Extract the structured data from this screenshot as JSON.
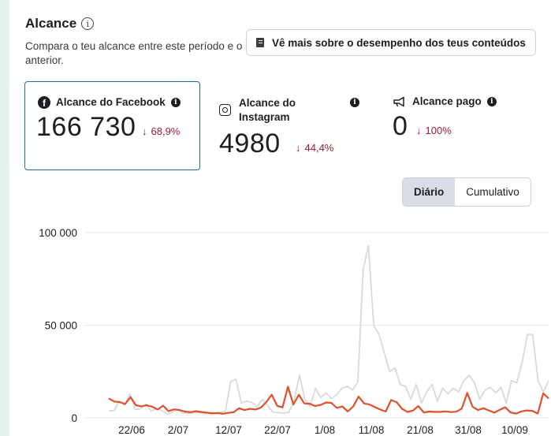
{
  "header": {
    "title": "Alcance",
    "info_glyph": "i",
    "subtitle": "Compara o teu alcance entre este período e o anterior."
  },
  "perf_button": {
    "label": "Vê mais sobre o desempenho dos teus conteúdos",
    "icon": "book-icon"
  },
  "cards": {
    "facebook": {
      "label": "Alcance do Facebook",
      "value": "166 730",
      "delta": "68,9%",
      "arrow": "↓",
      "icon": "facebook-icon",
      "selected": true
    },
    "instagram": {
      "label": "Alcance do Instagram",
      "value": "4980",
      "delta": "44,4%",
      "arrow": "↓",
      "icon": "instagram-icon"
    },
    "paid": {
      "label": "Alcance pago",
      "value": "0",
      "delta": "100%",
      "arrow": "↓",
      "icon": "megaphone-icon"
    }
  },
  "toggle": {
    "options": [
      "Diário",
      "Cumulativo"
    ],
    "selected": "Diário"
  },
  "colors": {
    "accent": "#1a73a8",
    "negative": "#9b1c31",
    "current_series": "#e0502a",
    "previous_series": "#d7d9dc"
  },
  "chart_data": {
    "type": "line",
    "x_ticks": [
      "22/06",
      "2/07",
      "12/07",
      "22/07",
      "1/08",
      "11/08",
      "21/08",
      "31/08",
      "10/09"
    ],
    "y_ticks": [
      "0",
      "50 000",
      "100 000"
    ],
    "ylim": [
      0,
      100000
    ],
    "grid": true,
    "series": [
      {
        "values": [
          10500,
          8800,
          8500,
          7500,
          11200,
          6800,
          6200,
          6800,
          6000,
          4500,
          6600,
          3600,
          4600,
          4200,
          3400,
          3000,
          3600,
          3200,
          2800,
          2400,
          2600,
          2200,
          2700,
          3000,
          5200,
          4200,
          4900,
          4500,
          5500,
          8500,
          12500,
          6500,
          5600,
          16800,
          7200,
          12500,
          7800,
          7600,
          6400,
          7000,
          8300,
          8100,
          5300,
          6200,
          3500,
          6100,
          11500,
          7800,
          7200,
          5800,
          4500,
          3400,
          9600,
          8500,
          4900,
          3200,
          3900,
          6400,
          2900,
          3400,
          3200,
          3200,
          3500,
          3100,
          3300,
          5000,
          13500,
          6000,
          4200,
          5200,
          4000,
          2800,
          4400,
          5700,
          2900,
          2300,
          3500,
          4000,
          3800,
          2300,
          13200,
          10500
        ]
      },
      {
        "values": [
          3800,
          4000,
          9000,
          7000,
          13000,
          4500,
          4900,
          7500,
          3600,
          5000,
          4000,
          2000,
          3000,
          4500,
          2500,
          2600,
          2600,
          2800,
          2200,
          2900,
          2600,
          3000,
          3500,
          19500,
          21000,
          8000,
          9000,
          8300,
          6000,
          10000,
          6500,
          3000,
          2800,
          2500,
          3000,
          10000,
          23000,
          10000,
          6000,
          16000,
          11000,
          13500,
          10500,
          12500,
          16000,
          17000,
          15000,
          19500,
          80000,
          93000,
          50000,
          45000,
          35000,
          25000,
          27000,
          18000,
          17000,
          10000,
          18000,
          8000,
          14000,
          18000,
          9000,
          16000,
          13000,
          16000,
          14000,
          20000,
          23000,
          19000,
          10000,
          15000,
          16500,
          13500,
          16500,
          8000,
          20000,
          19000,
          30000,
          45000,
          45000,
          20000,
          14000,
          20000
        ]
      }
    ]
  }
}
